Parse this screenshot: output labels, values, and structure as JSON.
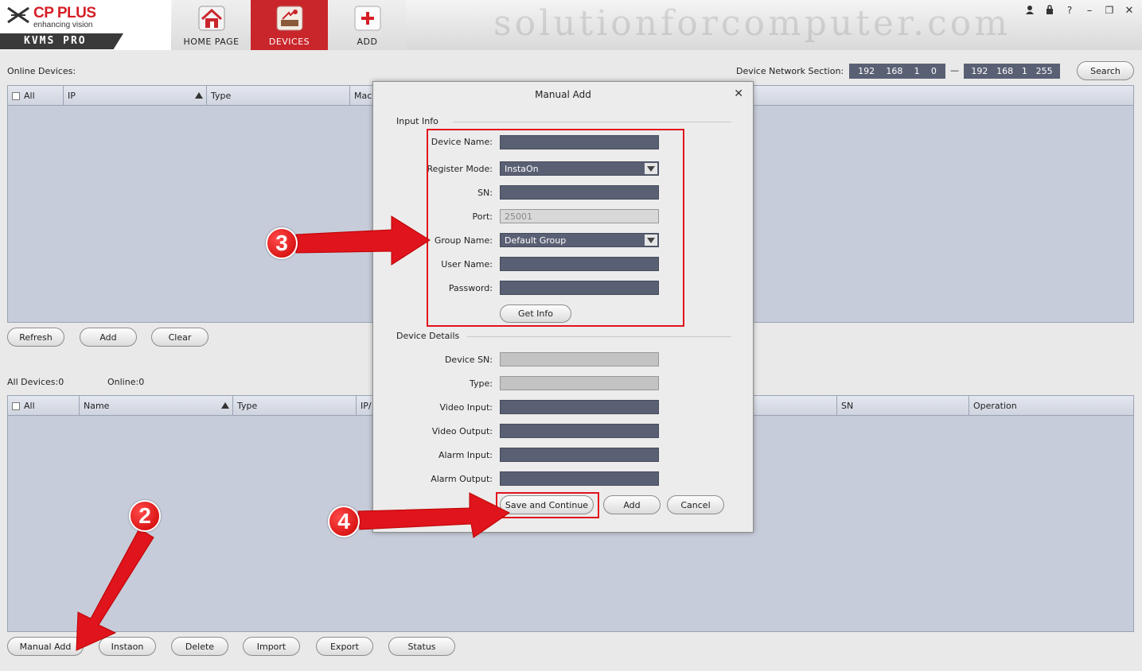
{
  "brand": {
    "name": "CP PLUS",
    "tagline": "enhancing vision",
    "product": "KVMS PRO"
  },
  "nav": {
    "tabs": [
      {
        "label": "HOME PAGE",
        "icon": "house-icon"
      },
      {
        "label": "DEVICES",
        "icon": "devices-icon",
        "active": true
      },
      {
        "label": "ADD",
        "icon": "add-plus-icon"
      }
    ]
  },
  "watermark": "solutionforcomputer.com",
  "window_controls": [
    "user-icon",
    "lock-icon",
    "help-icon",
    "minimize-icon",
    "restore-icon",
    "close-icon"
  ],
  "online": {
    "label": "Online Devices:",
    "network_label": "Device Network Section:",
    "ip_start": [
      "192",
      "168",
      "1",
      "0"
    ],
    "ip_dash": "—",
    "ip_end": [
      "192",
      "168",
      "1",
      "255"
    ],
    "search": "Search",
    "columns": [
      "All",
      "IP",
      "Type",
      "Mac"
    ],
    "buttons": {
      "refresh": "Refresh",
      "add": "Add",
      "clear": "Clear"
    }
  },
  "all_devices": {
    "count_label": "All Devices:0",
    "online_label": "Online:0",
    "columns": [
      "All",
      "Name",
      "Type",
      "IP/",
      "SN",
      "Operation"
    ],
    "buttons": [
      "Manual Add",
      "Instaon",
      "Delete",
      "Import",
      "Export",
      "Status"
    ]
  },
  "dialog": {
    "title": "Manual Add",
    "input_info": "Input Info",
    "fields": {
      "device_name": {
        "label": "Device Name:",
        "value": ""
      },
      "register_mode": {
        "label": "Register Mode:",
        "value": "InstaOn"
      },
      "sn": {
        "label": "SN:",
        "value": ""
      },
      "port": {
        "label": "Port:",
        "value": "25001"
      },
      "group_name": {
        "label": "Group Name:",
        "value": "Default Group"
      },
      "user_name": {
        "label": "User Name:",
        "value": ""
      },
      "password": {
        "label": "Password:",
        "value": ""
      }
    },
    "get_info": "Get Info",
    "device_details": "Device Details",
    "details": {
      "device_sn": "Device SN:",
      "type": "Type:",
      "video_input": "Video Input:",
      "video_output": "Video Output:",
      "alarm_input": "Alarm Input:",
      "alarm_output": "Alarm Output:"
    },
    "buttons": {
      "save_continue": "Save and Continue",
      "add": "Add",
      "cancel": "Cancel"
    }
  },
  "annotations": {
    "badge2": "2",
    "badge3": "3",
    "badge4": "4",
    "color": "#e0141c"
  }
}
